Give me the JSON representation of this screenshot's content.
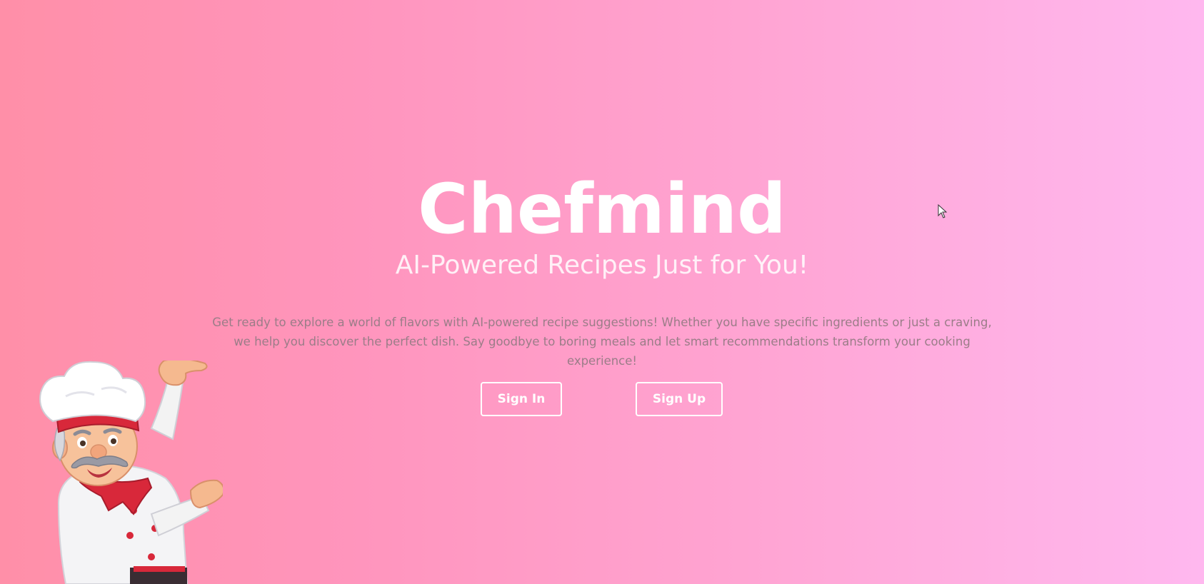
{
  "hero": {
    "title": "Chefmind",
    "tagline": "AI-Powered Recipes Just for You!",
    "description": "Get ready to explore a world of flavors with AI-powered recipe suggestions! Whether you have specific ingredients or just a craving, we help you discover the perfect dish. Say goodbye to boring meals and let smart recommendations transform your cooking experience!"
  },
  "auth": {
    "signin_label": "Sign In",
    "signup_label": "Sign Up"
  },
  "icons": {
    "mascot": "chef-mascot-icon",
    "cursor": "mouse-cursor-icon"
  },
  "colors": {
    "gradient_start": "#ff8fa8",
    "gradient_end": "#ffb8ef",
    "text_primary": "#ffffff",
    "text_muted": "#9b7d88",
    "chef_accent": "#d8283a"
  }
}
